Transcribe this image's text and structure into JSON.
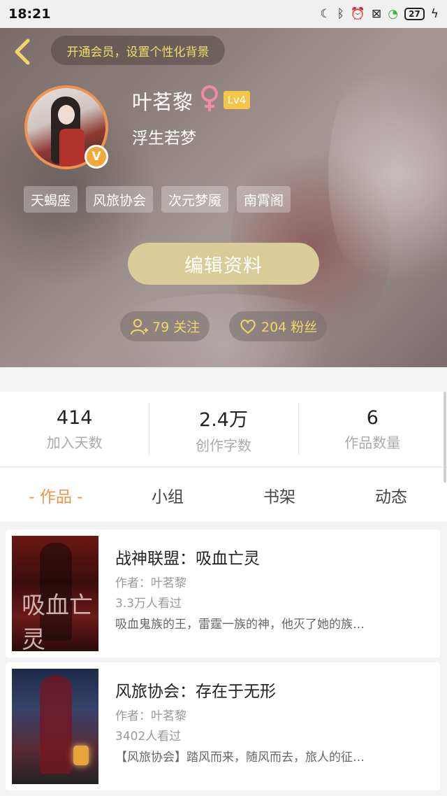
{
  "status_bar": {
    "time": "18:21",
    "battery": "27"
  },
  "header": {
    "vip_banner": "开通会员，设置个性化背景",
    "username": "叶茗黎",
    "level": "Lv4",
    "vip_mark": "V",
    "signature": "浮生若梦",
    "tags": [
      "天蝎座",
      "风旅协会",
      "次元梦魇",
      "南霄阁"
    ],
    "edit_button": "编辑资料",
    "following": "79 关注",
    "fans": "204 粉丝",
    "colors": {
      "accent": "#ee9350",
      "gold": "#f3d766",
      "edit_button": "#d9cc99"
    }
  },
  "stats": [
    {
      "value": "414",
      "label": "加入天数"
    },
    {
      "value": "2.4万",
      "label": "创作字数"
    },
    {
      "value": "6",
      "label": "作品数量"
    }
  ],
  "tabs": [
    {
      "label": "- 作品 -",
      "active": true
    },
    {
      "label": "小组",
      "active": false
    },
    {
      "label": "书架",
      "active": false
    },
    {
      "label": "动态",
      "active": false
    }
  ],
  "works": [
    {
      "title": "战神联盟：吸血亡灵",
      "author": "作者：叶茗黎",
      "views": "3.3万人看过",
      "description": "吸血鬼族的王，雷霆一族的神，他灭了她的族…",
      "cover_text": "吸血亡灵"
    },
    {
      "title": "风旅协会：存在于无形",
      "author": "作者：叶茗黎",
      "views": "3402人看过",
      "description": "【风旅协会】踏风而来，随风而去，旅人的征…"
    }
  ]
}
